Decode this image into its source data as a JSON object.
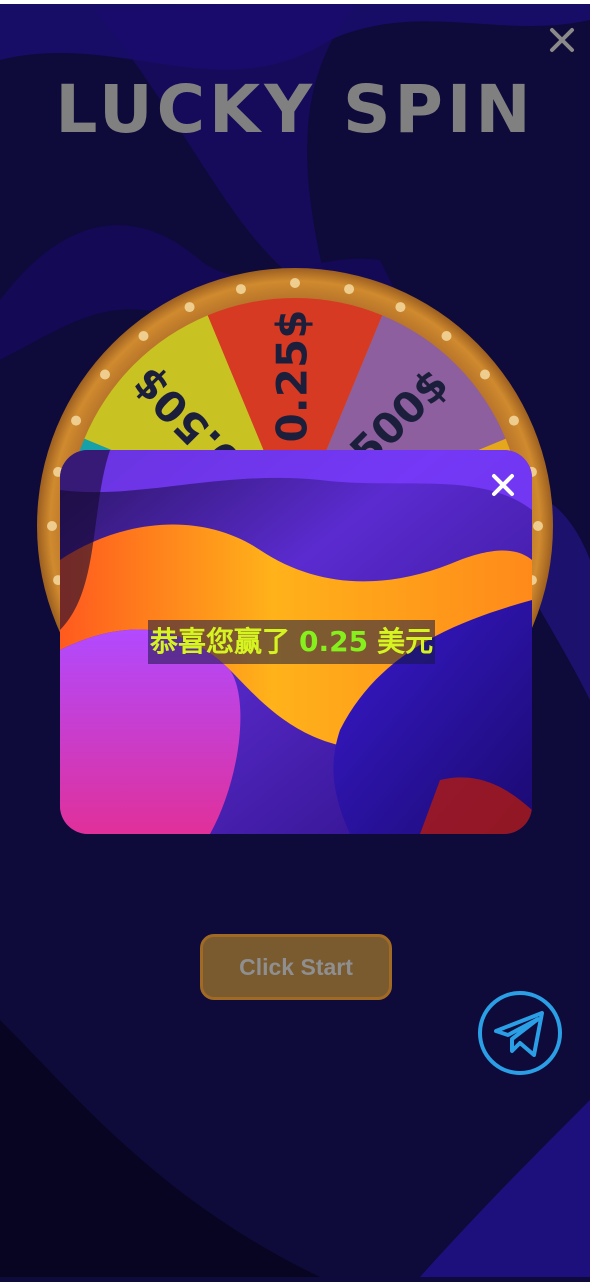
{
  "title": "LUCKY SPIN",
  "wheel": {
    "segments": [
      {
        "label": "0.50$",
        "color": "#c8c323"
      },
      {
        "label": "0.25$",
        "color": "#d63a22"
      },
      {
        "label": "500$",
        "color": "#8d5f9e"
      },
      {
        "label": "",
        "color": "#e5a81c"
      },
      {
        "label": "",
        "color": "#e07a1e"
      },
      {
        "label": "",
        "color": "#3a8a3a"
      },
      {
        "label": "",
        "color": "#2f5fa8"
      },
      {
        "label": "",
        "color": "#16a0a8"
      }
    ]
  },
  "modal": {
    "message_prefix": "恭喜您赢了",
    "amount": "0.25",
    "currency": "美元"
  },
  "buttons": {
    "start_label": "Click Start"
  },
  "colors": {
    "background": "#0f0a3c",
    "button_bg": "#7a5a2f",
    "telegram": "#2b9fe6",
    "message_yellow": "#d6f520",
    "message_green": "#86f01c"
  },
  "icons": {
    "page_close": "close-icon",
    "modal_close": "close-icon",
    "telegram": "telegram-icon"
  }
}
